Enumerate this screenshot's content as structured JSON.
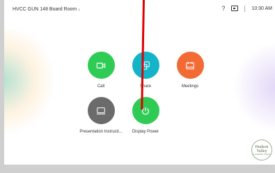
{
  "topbar": {
    "room_name": "HVCC GUN 148 Board Room",
    "help_glyph": "?",
    "time": "10:30 AM"
  },
  "tiles": {
    "call": {
      "label": "Call",
      "color": "#2ecc55",
      "icon": "camera-icon"
    },
    "share": {
      "label": "Share",
      "color": "#14b4c8",
      "icon": "share-icon"
    },
    "meetings": {
      "label": "Meetings",
      "color": "#f26b35",
      "icon": "calendar-icon"
    },
    "presentation": {
      "label": "Presentation Instructi...",
      "color": "#6b6b6b",
      "icon": "monitor-icon"
    },
    "display_power": {
      "label": "Display Power",
      "color": "#2ecc55",
      "icon": "power-icon"
    }
  },
  "logo": {
    "line1": "Hudson",
    "line2": "Valley",
    "line3": "Community College"
  }
}
